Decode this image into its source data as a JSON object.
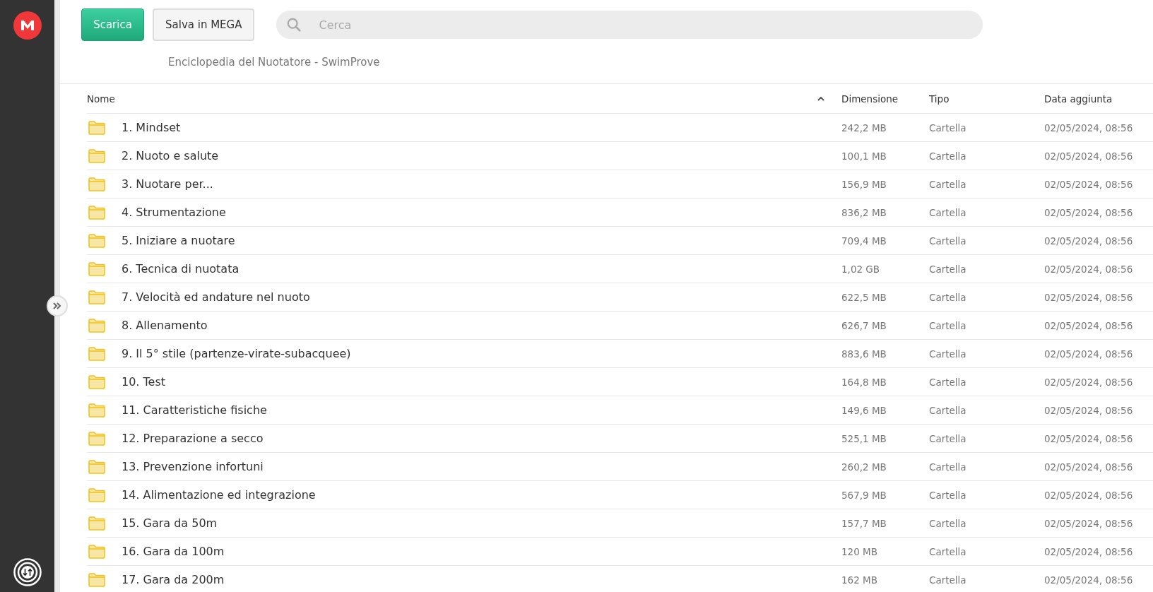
{
  "toolbar": {
    "buttons": [
      {
        "label": "Scarica",
        "kind": "primary"
      },
      {
        "label": "Salva in MEGA",
        "kind": "secondary"
      }
    ],
    "search": {
      "placeholder": "Cerca"
    }
  },
  "folder_title": "Enciclopedia del Nuotatore - SwimProve",
  "table": {
    "columns": [
      {
        "label": "Nome",
        "sorted": true
      },
      {
        "label": "Dimensione",
        "sorted": false
      },
      {
        "label": "Tipo",
        "sorted": false
      },
      {
        "label": "Data aggiunta",
        "sorted": false
      }
    ],
    "rows": [
      {
        "name": "1. Mindset",
        "size": "242,2 MB",
        "type": "Cartella",
        "date": "02/05/2024, 08:56"
      },
      {
        "name": "2. Nuoto e salute",
        "size": "100,1 MB",
        "type": "Cartella",
        "date": "02/05/2024, 08:56"
      },
      {
        "name": "3. Nuotare per...",
        "size": "156,9 MB",
        "type": "Cartella",
        "date": "02/05/2024, 08:56"
      },
      {
        "name": "4. Strumentazione",
        "size": "836,2 MB",
        "type": "Cartella",
        "date": "02/05/2024, 08:56"
      },
      {
        "name": "5. Iniziare a nuotare",
        "size": "709,4 MB",
        "type": "Cartella",
        "date": "02/05/2024, 08:56"
      },
      {
        "name": "6. Tecnica di nuotata",
        "size": "1,02 GB",
        "type": "Cartella",
        "date": "02/05/2024, 08:56"
      },
      {
        "name": "7. Velocità ed andature nel nuoto",
        "size": "622,5 MB",
        "type": "Cartella",
        "date": "02/05/2024, 08:56"
      },
      {
        "name": "8. Allenamento",
        "size": "626,7 MB",
        "type": "Cartella",
        "date": "02/05/2024, 08:56"
      },
      {
        "name": "9. Il 5° stile (partenze-virate-subacquee)",
        "size": "883,6 MB",
        "type": "Cartella",
        "date": "02/05/2024, 08:56"
      },
      {
        "name": "10. Test",
        "size": "164,8 MB",
        "type": "Cartella",
        "date": "02/05/2024, 08:56"
      },
      {
        "name": "11. Caratteristiche fisiche",
        "size": "149,6 MB",
        "type": "Cartella",
        "date": "02/05/2024, 08:56"
      },
      {
        "name": "12. Preparazione a secco",
        "size": "525,1 MB",
        "type": "Cartella",
        "date": "02/05/2024, 08:56"
      },
      {
        "name": "13. Prevenzione infortuni",
        "size": "260,2 MB",
        "type": "Cartella",
        "date": "02/05/2024, 08:56"
      },
      {
        "name": "14. Alimentazione ed integrazione",
        "size": "567,9 MB",
        "type": "Cartella",
        "date": "02/05/2024, 08:56"
      },
      {
        "name": "15. Gara da 50m",
        "size": "157,7 MB",
        "type": "Cartella",
        "date": "02/05/2024, 08:56"
      },
      {
        "name": "16. Gara da 100m",
        "size": "120 MB",
        "type": "Cartella",
        "date": "02/05/2024, 08:56"
      },
      {
        "name": "17. Gara da 200m",
        "size": "162 MB",
        "type": "Cartella",
        "date": "02/05/2024, 08:56"
      }
    ]
  }
}
